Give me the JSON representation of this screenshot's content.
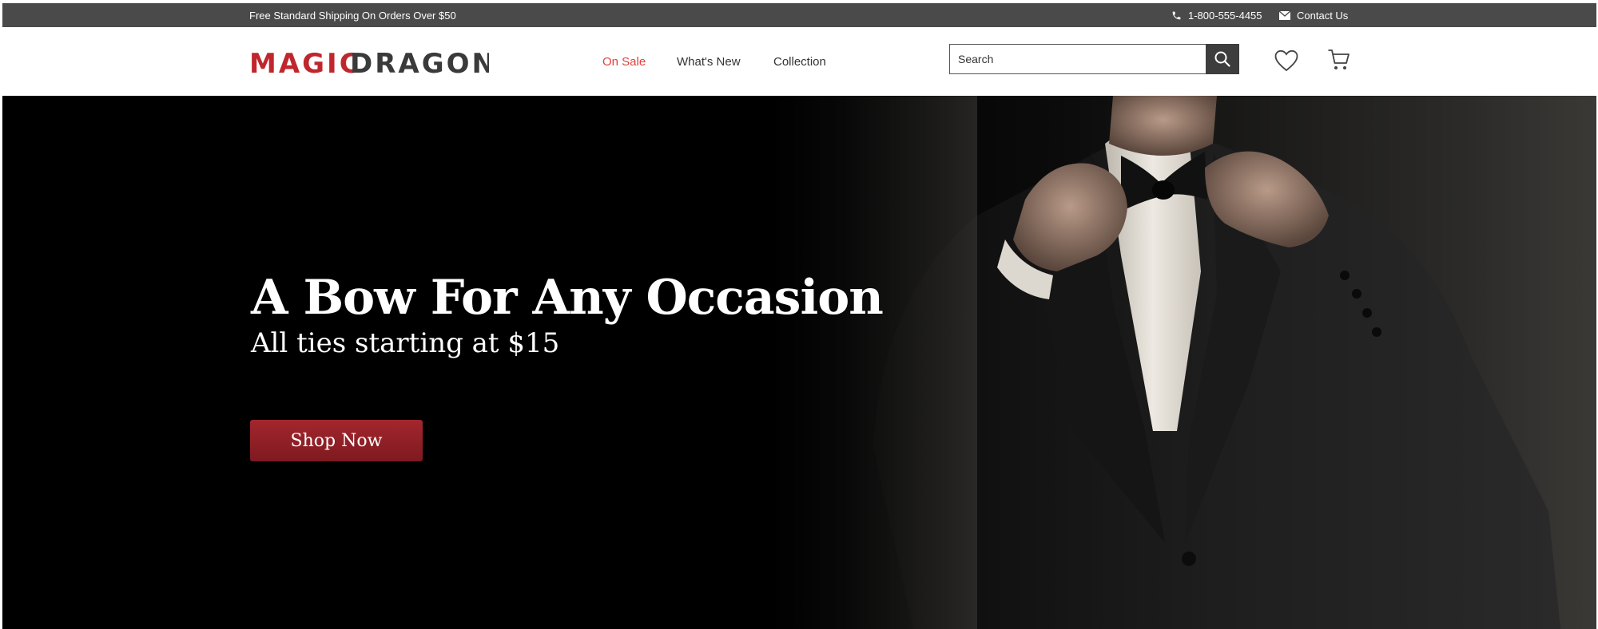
{
  "topbar": {
    "shipping_text": "Free Standard Shipping On Orders Over $50",
    "phone": "1-800-555-4455",
    "contact": "Contact Us"
  },
  "header": {
    "logo_part1": "MAGIC",
    "logo_part2": "DRAGON",
    "nav": [
      {
        "label": "On Sale",
        "active": true
      },
      {
        "label": "What's New",
        "active": false
      },
      {
        "label": "Collection",
        "active": false
      }
    ],
    "search_placeholder": "Search"
  },
  "hero": {
    "title": "A Bow For Any Occasion",
    "subtitle": "All ties starting at $15",
    "cta": "Shop Now"
  },
  "colors": {
    "accent": "#e0413c",
    "logo_red": "#c0262d",
    "logo_dark": "#3a3a3a",
    "cta": "#8e1e25",
    "topbar": "#4a4a4a"
  },
  "icons": [
    "phone-icon",
    "mail-icon",
    "search-icon",
    "heart-icon",
    "cart-icon"
  ]
}
